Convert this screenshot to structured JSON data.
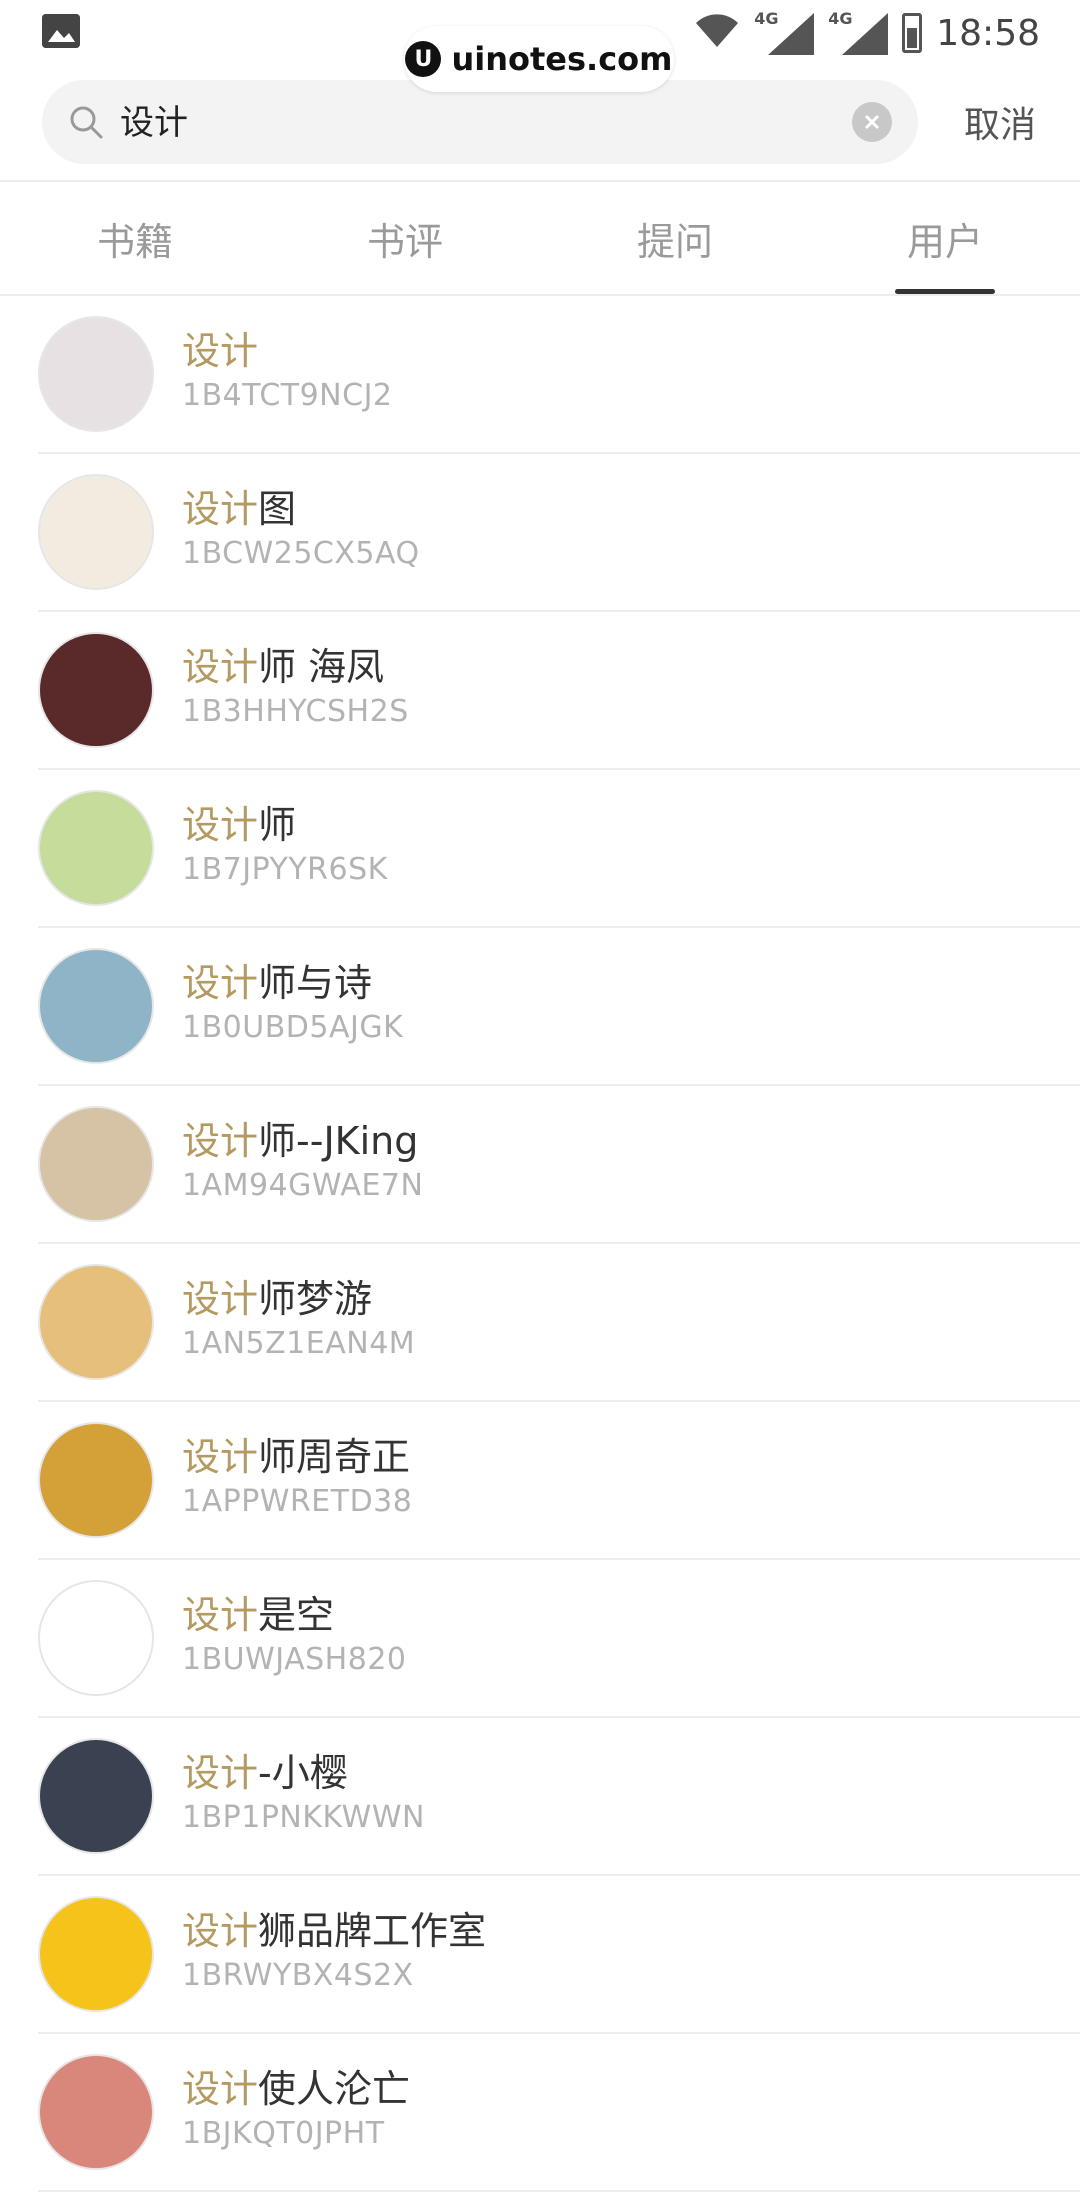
{
  "status_bar": {
    "time": "18:58",
    "network_1": "4G",
    "network_2": "4G",
    "icons": [
      "image-icon",
      "wifi-icon",
      "signal-icon",
      "signal-icon",
      "battery-icon"
    ]
  },
  "watermark": {
    "text": "uinotes.com",
    "logo_letter": "U"
  },
  "search": {
    "value": "设计",
    "placeholder": "",
    "cancel_label": "取消"
  },
  "tabs": [
    {
      "label": "书籍",
      "active": false
    },
    {
      "label": "书评",
      "active": false
    },
    {
      "label": "提问",
      "active": false
    },
    {
      "label": "用户",
      "active": true
    }
  ],
  "highlight_color": "#b49a60",
  "results": [
    {
      "highlight": "设计",
      "rest": "",
      "uid": "1B4TCT9NCJ2",
      "avatar_color": "#e8e1e4"
    },
    {
      "highlight": "设计",
      "rest": "图",
      "uid": "1BCW25CX5AQ",
      "avatar_color": "#f2ece0"
    },
    {
      "highlight": "设计",
      "rest": "师 海凤",
      "uid": "1B3HHYCSH2S",
      "avatar_color": "#5a2a2a"
    },
    {
      "highlight": "设计",
      "rest": "师",
      "uid": "1B7JPYYR6SK",
      "avatar_color": "#c6dc9a"
    },
    {
      "highlight": "设计",
      "rest": "师与诗",
      "uid": "1B0UBD5AJGK",
      "avatar_color": "#8fb4c8"
    },
    {
      "highlight": "设计",
      "rest": "师--JKing",
      "uid": "1AM94GWAE7N",
      "avatar_color": "#d6c2a4"
    },
    {
      "highlight": "设计",
      "rest": "师梦游",
      "uid": "1AN5Z1EAN4M",
      "avatar_color": "#e6c07a"
    },
    {
      "highlight": "设计",
      "rest": "师周奇正",
      "uid": "1APPWRETD38",
      "avatar_color": "#d4a038"
    },
    {
      "highlight": "设计",
      "rest": "是空",
      "uid": "1BUWJASH820",
      "avatar_color": "#ffffff"
    },
    {
      "highlight": "设计",
      "rest": "-小樱",
      "uid": "1BP1PNKKWWN",
      "avatar_color": "#3a4150"
    },
    {
      "highlight": "设计",
      "rest": "狮品牌工作室",
      "uid": "1BRWYBX4S2X",
      "avatar_color": "#f5c31a"
    },
    {
      "highlight": "设计",
      "rest": "使人沦亡",
      "uid": "1BJKQT0JPHT",
      "avatar_color": "#d9877a"
    }
  ]
}
